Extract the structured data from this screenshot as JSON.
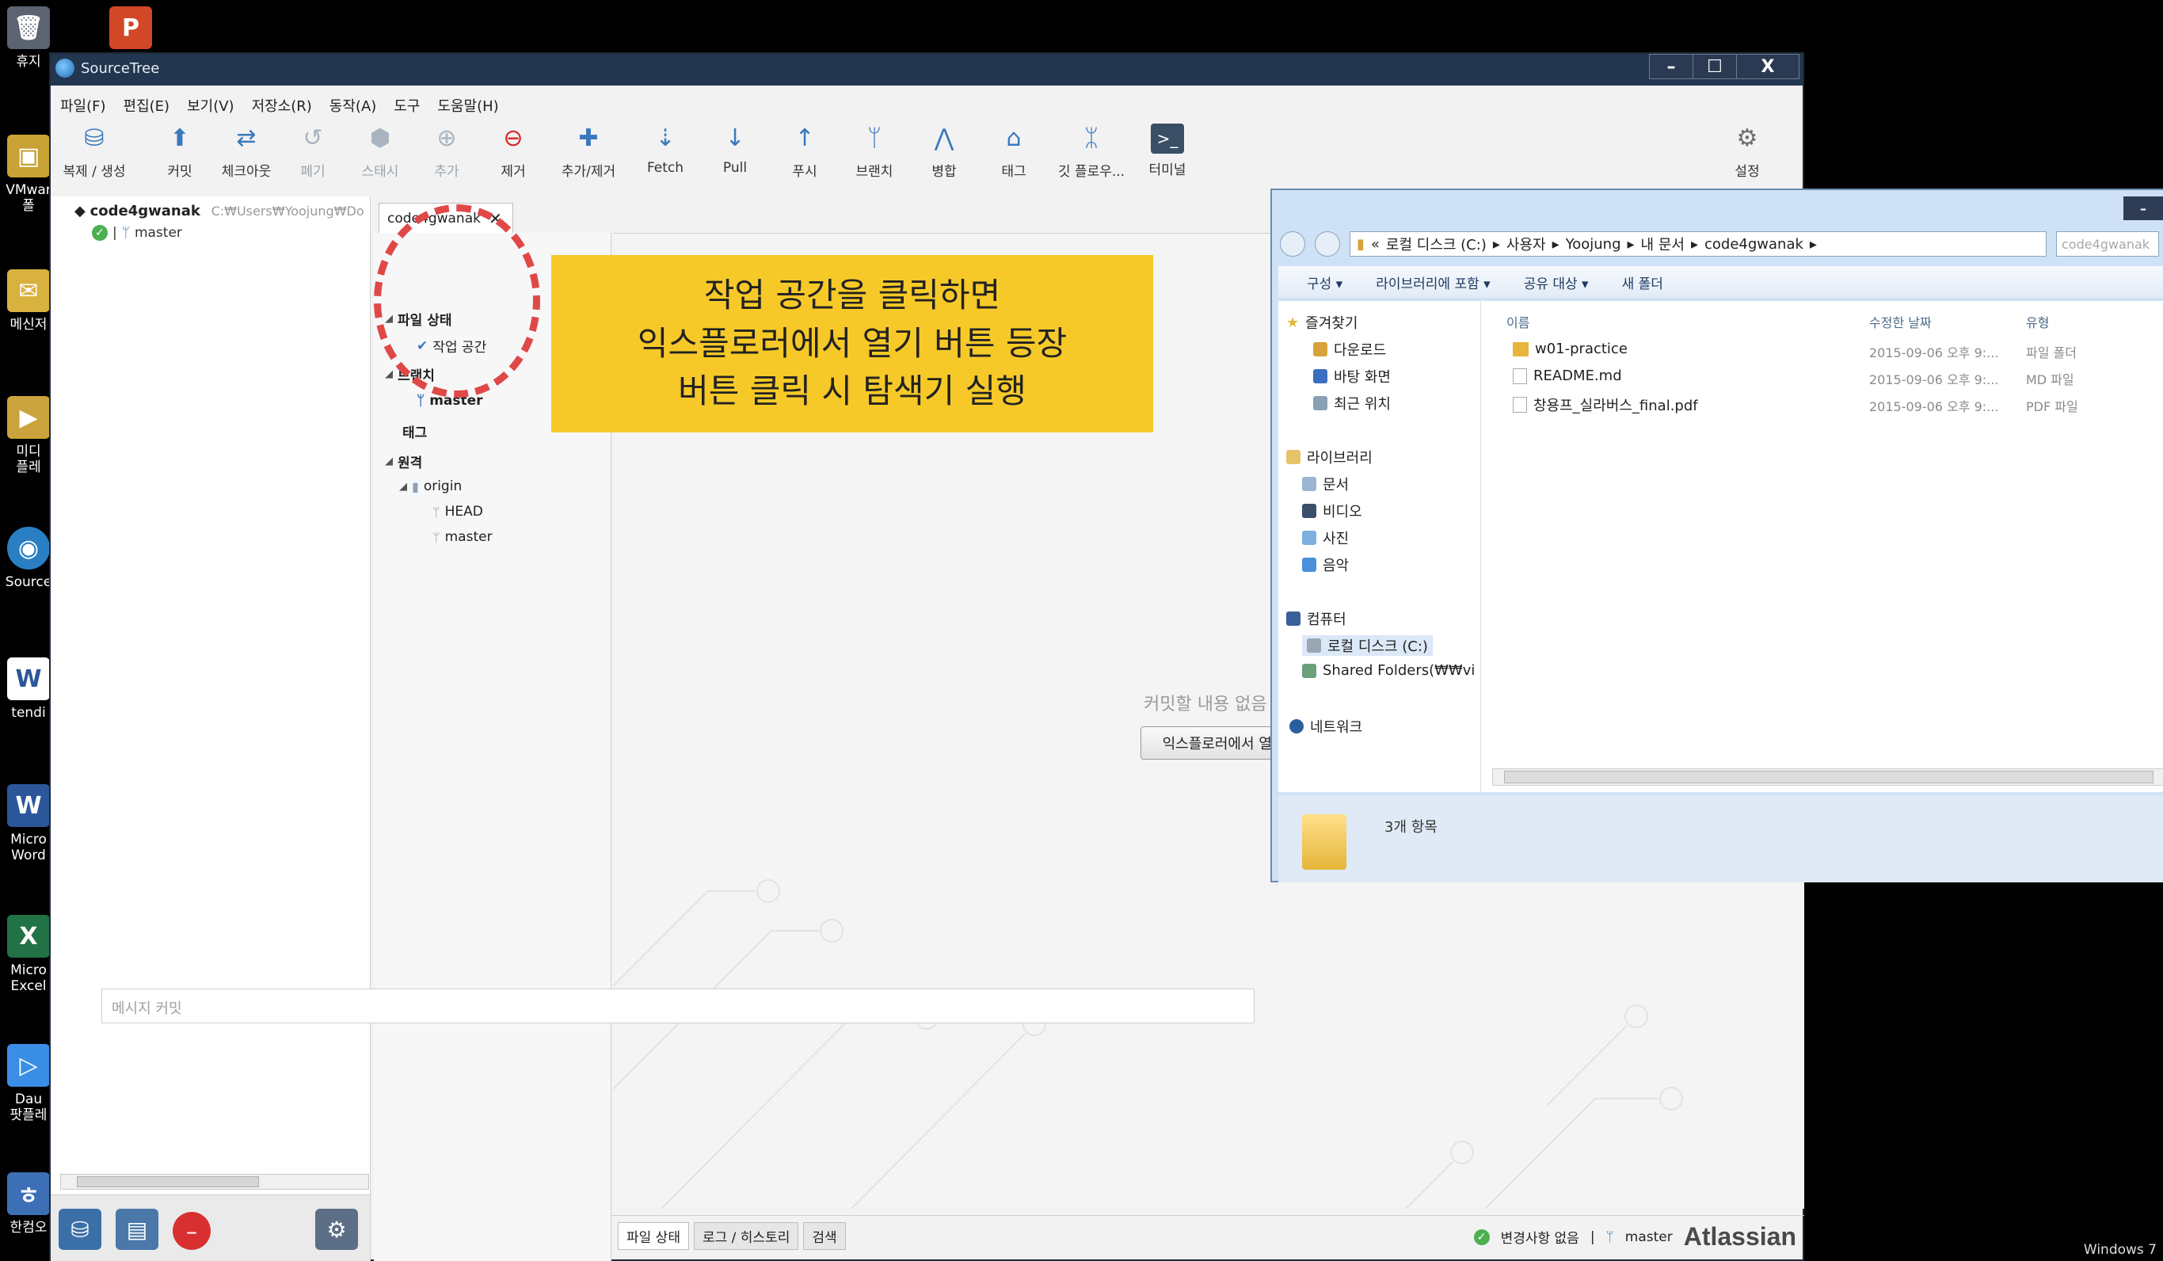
{
  "desktop": {
    "icons": [
      {
        "label": "휴지",
        "icon": "recycle-bin-icon"
      },
      {
        "label": "VMwar\n폴",
        "icon": "vmware-icon"
      },
      {
        "label": "메신저",
        "icon": "messenger-icon"
      },
      {
        "label": "미디\n플레",
        "icon": "media-player-icon"
      },
      {
        "label": "Source",
        "icon": "sourcetree-icon"
      },
      {
        "label": "tendi",
        "icon": "word-file-icon"
      },
      {
        "label": "Micro\nWord",
        "icon": "word-icon"
      },
      {
        "label": "Micro\nExcel",
        "icon": "excel-icon"
      },
      {
        "label": "Dau\n팟플레",
        "icon": "potplayer-icon"
      },
      {
        "label": "한컴오",
        "icon": "hancom-icon"
      }
    ],
    "os_label": "Windows 7"
  },
  "sourcetree": {
    "title": "SourceTree",
    "window_buttons": {
      "minimize": "–",
      "maximize": "☐",
      "close": "X"
    },
    "menu": [
      "파일(F)",
      "편집(E)",
      "보기(V)",
      "저장소(R)",
      "동작(A)",
      "도구",
      "도움말(H)"
    ],
    "toolbar": [
      {
        "label": "복제 / 생성",
        "glyph": "⛁",
        "state": "normal"
      },
      {
        "label": "커밋",
        "glyph": "⬆",
        "state": "normal"
      },
      {
        "label": "체크아웃",
        "glyph": "⇄",
        "state": "normal"
      },
      {
        "label": "폐기",
        "glyph": "↺",
        "state": "disabled"
      },
      {
        "label": "스태시",
        "glyph": "⬢",
        "state": "disabled"
      },
      {
        "label": "추가",
        "glyph": "⊕",
        "state": "disabled"
      },
      {
        "label": "제거",
        "glyph": "⊖",
        "state": "red"
      },
      {
        "label": "추가/제거",
        "glyph": "✚",
        "state": "normal"
      },
      {
        "label": "Fetch",
        "glyph": "⇣",
        "state": "normal"
      },
      {
        "label": "Pull",
        "glyph": "↓",
        "state": "normal"
      },
      {
        "label": "푸시",
        "glyph": "↑",
        "state": "normal"
      },
      {
        "label": "브랜치",
        "glyph": "ᛘ",
        "state": "normal"
      },
      {
        "label": "병합",
        "glyph": "⋀",
        "state": "normal"
      },
      {
        "label": "태그",
        "glyph": "⌂",
        "state": "normal"
      },
      {
        "label": "깃 플로우...",
        "glyph": "ᛯ",
        "state": "normal"
      },
      {
        "label": "터미널",
        "glyph": ">_",
        "state": "normal"
      }
    ],
    "settings_label": "설정",
    "sidebar": {
      "repo_name": "code4gwanak",
      "repo_path": "C:₩Users₩Yoojung₩Do",
      "branch": "master"
    },
    "tab": {
      "label": "code4gwanak",
      "close": "✕"
    },
    "tree": {
      "file_status": "파일 상태",
      "workspace": "작업 공간",
      "branches": "브랜치",
      "branch_master": "master",
      "tags": "태그",
      "remotes": "원격",
      "origin": "origin",
      "head": "HEAD",
      "remote_master": "master"
    },
    "workspace": {
      "empty_text": "커밋할 내용 없음",
      "open_explorer": "익스플로러에서 열기",
      "commit_placeholder": "메시지 커밋"
    },
    "bottom_tabs": [
      "파일 상태",
      "로그 / 히스토리",
      "검색"
    ],
    "status": {
      "no_changes": "변경사항 없음",
      "branch": "master",
      "brand": "Atlassian"
    }
  },
  "callout": {
    "lines": [
      "작업 공간을 클릭하면",
      "익스플로러에서 열기 버튼 등장",
      "버튼 클릭 시 탐색기 실행"
    ],
    "color": "#f6c928"
  },
  "explorer": {
    "address": [
      "로컬 디스크 (C:)",
      "사용자",
      "Yoojung",
      "내 문서",
      "code4gwanak"
    ],
    "search_placeholder": "code4gwanak",
    "commands": [
      "구성 ▾",
      "라이브러리에 포함 ▾",
      "공유 대상 ▾",
      "새 폴더"
    ],
    "nav": {
      "favorites": "즐겨찾기",
      "downloads": "다운로드",
      "desktop": "바탕 화면",
      "recent": "최근 위치",
      "libraries": "라이브러리",
      "documents": "문서",
      "videos": "비디오",
      "pictures": "사진",
      "music": "음악",
      "computer": "컴퓨터",
      "local_disk": "로컬 디스크 (C:)",
      "shared": "Shared Folders(₩₩vi",
      "network": "네트워크"
    },
    "columns": {
      "name": "이름",
      "modified": "수정한 날짜",
      "type": "유형"
    },
    "files": [
      {
        "name": "w01-practice",
        "modified": "2015-09-06 오후 9:...",
        "type": "파일 폴더"
      },
      {
        "name": "README.md",
        "modified": "2015-09-06 오후 9:...",
        "type": "MD 파일"
      },
      {
        "name": "창용프_실라버스_final.pdf",
        "modified": "2015-09-06 오후 9:...",
        "type": "PDF 파일"
      }
    ],
    "item_count": "3개 항목"
  }
}
